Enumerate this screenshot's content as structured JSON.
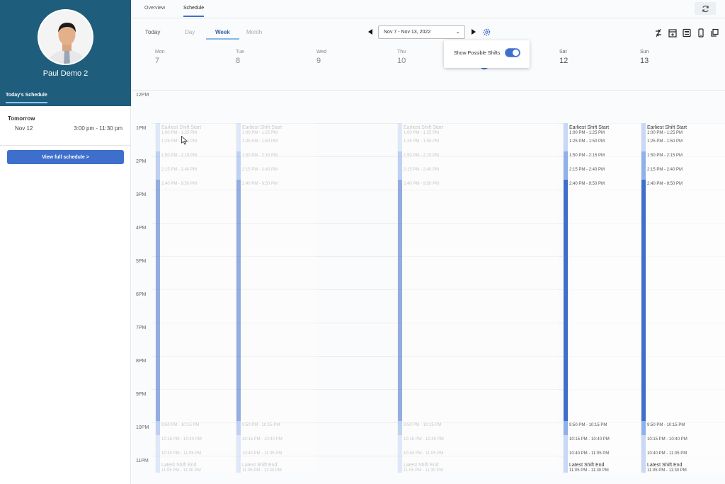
{
  "profile": {
    "name": "Paul Demo 2",
    "tab": "Today's Schedule"
  },
  "upcoming": {
    "title": "Tomorrow",
    "date": "Nov 12",
    "time": "3:00 pm - 11:30 pm",
    "button": "View full schedule >"
  },
  "nav": {
    "tabs": [
      "Overview",
      "Schedule"
    ],
    "active": "Schedule"
  },
  "views": {
    "today": "Today",
    "day": "Day",
    "week": "Week",
    "month": "Month"
  },
  "range": {
    "label": "Nov 7 - Nov 13, 2022"
  },
  "popover": {
    "label": "Show Possible Shifts",
    "toggle_on": true
  },
  "days": [
    {
      "name": "Mon",
      "num": "7"
    },
    {
      "name": "Tue",
      "num": "8"
    },
    {
      "name": "Wed",
      "num": "9"
    },
    {
      "name": "Thu",
      "num": "10"
    },
    {
      "name": "Sat",
      "num": "12"
    },
    {
      "name": "Sun",
      "num": "13"
    }
  ],
  "hours": [
    "12PM",
    "1PM",
    "2PM",
    "3PM",
    "4PM",
    "5PM",
    "6PM",
    "7PM",
    "8PM",
    "9PM",
    "10PM",
    "11PM"
  ],
  "shifts": {
    "earliest_title": "Earliest Shift Start",
    "earliest_time": "1:00 PM - 1:25 PM",
    "slot_1": "1:25 PM - 1:50 PM",
    "slot_2": "1:50 PM - 2:15 PM",
    "slot_3": "2:15 PM - 2:40 PM",
    "slot_4": "2:40 PM - 9:50 PM",
    "slot_5": "9:50 PM - 10:15 PM",
    "slot_6": "10:15 PM - 10:40 PM",
    "slot_7": "10:40 PM - 11:05 PM",
    "latest_title": "Latest Shift End",
    "latest_time": "11:05 PM - 11:30 PM"
  },
  "colors": {
    "sidebar": "#1f5d7c",
    "accent": "#3f6fcc",
    "light_slot": "#c9d9f5",
    "mid_slot": "#8fb0ea"
  }
}
